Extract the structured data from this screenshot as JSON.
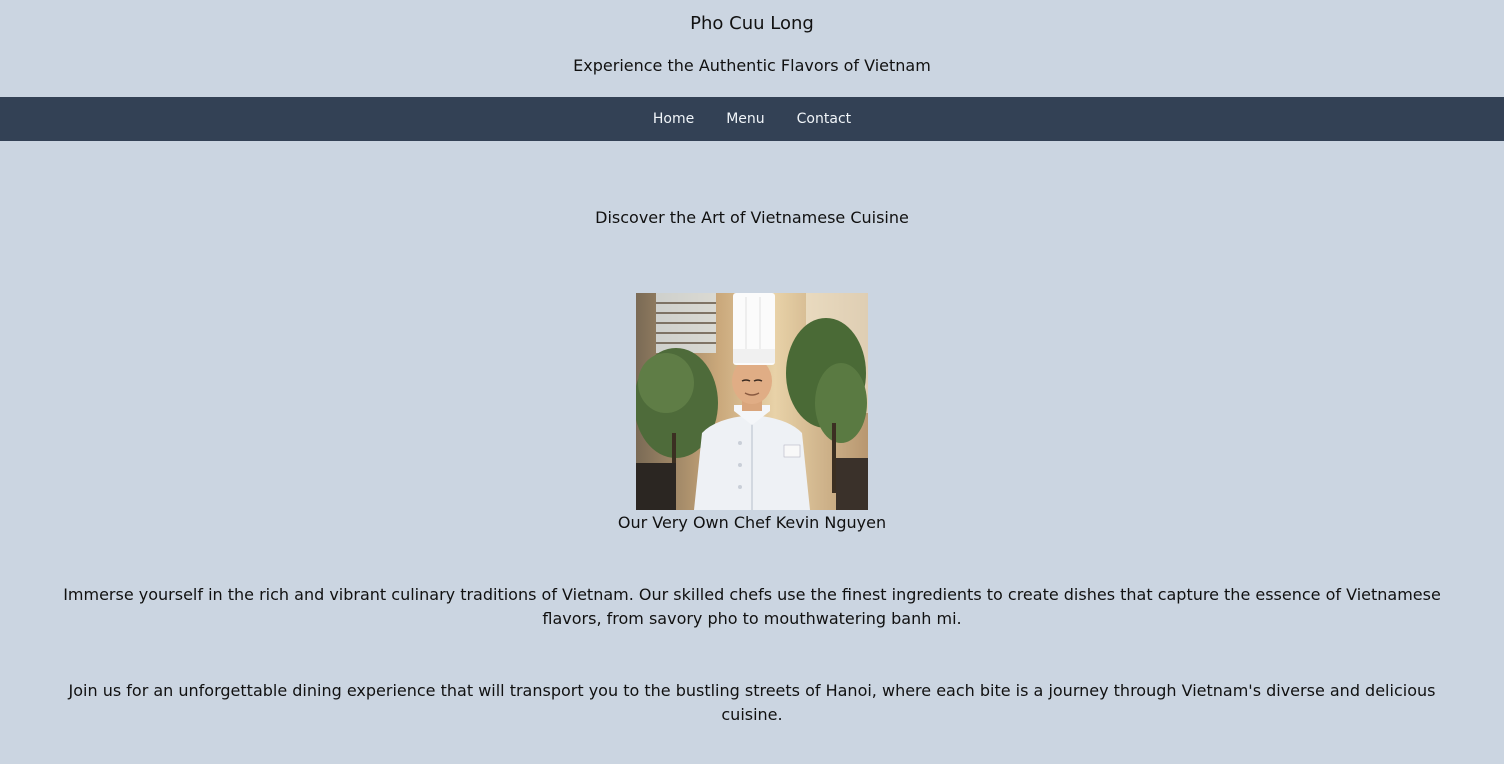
{
  "header": {
    "title": "Pho Cuu Long",
    "tagline": "Experience the Authentic Flavors of Vietnam"
  },
  "nav": {
    "items": [
      {
        "label": "Home"
      },
      {
        "label": "Menu"
      },
      {
        "label": "Contact"
      }
    ]
  },
  "main": {
    "section_title": "Discover the Art of Vietnamese Cuisine",
    "chef_caption": "Our Very Own Chef Kevin Nguyen",
    "paragraphs": [
      "Immerse yourself in the rich and vibrant culinary traditions of Vietnam. Our skilled chefs use the finest ingredients to create dishes that capture the essence of Vietnamese flavors, from savory pho to mouthwatering banh mi.",
      "Join us for an unforgettable dining experience that will transport you to the bustling streets of Hanoi, where each bite is a journey through Vietnam's diverse and delicious cuisine."
    ]
  },
  "colors": {
    "page_background": "#cbd5e1",
    "nav_background": "#334155",
    "nav_text": "#f1f5f9"
  }
}
